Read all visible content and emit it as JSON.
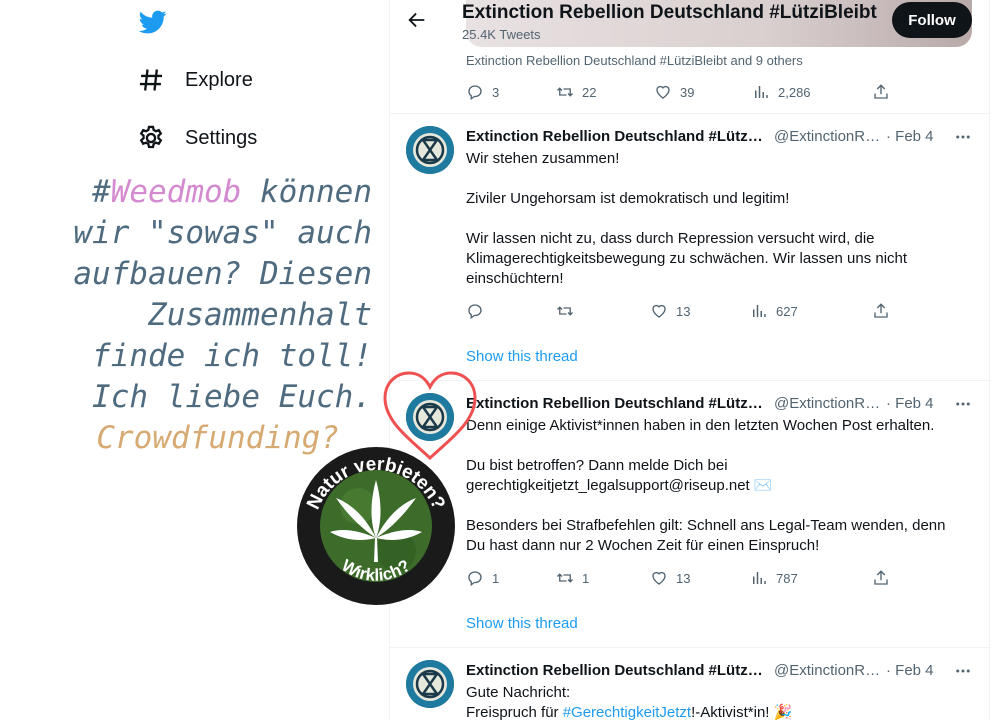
{
  "sidebar": {
    "items": [
      {
        "label": "Explore",
        "icon": "hashtag-icon"
      },
      {
        "label": "Settings",
        "icon": "gear-icon"
      }
    ]
  },
  "overlay": {
    "lines": [
      {
        "parts": [
          "#",
          "Weedmob",
          " können"
        ]
      },
      {
        "text": "wir \"sowas\" auch"
      },
      {
        "text": "aufbauen? Diesen"
      },
      {
        "text": "Zusammenhalt"
      },
      {
        "text": "finde ich toll!"
      },
      {
        "text": "Ich liebe Euch."
      },
      {
        "text": "Crowdfunding?"
      }
    ],
    "sticker_top": "Natur verbieten?",
    "sticker_bottom": "Wirklich?"
  },
  "header": {
    "title": "Extinction Rebellion Deutschland #LütziBleibt",
    "tweet_count": "25.4K Tweets",
    "follow_label": "Follow"
  },
  "top_tweet": {
    "liked_by": "Extinction Rebellion Deutschland #LütziBleibt and 9 others",
    "replies": "3",
    "retweets": "22",
    "likes": "39",
    "views": "2,286"
  },
  "tweets": [
    {
      "name": "Extinction Rebellion Deutschland #LütziBleibt",
      "handle": "@ExtinctionRebellion",
      "date": "· Feb 4",
      "paragraphs": [
        "Wir stehen zusammen!",
        "Ziviler Ungehorsam ist demokratisch und legitim!",
        "Wir lassen nicht zu, dass durch Repression versucht wird, die Klimagerechtigkeitsbewegung zu schwächen. Wir lassen uns nicht einschüchtern!"
      ],
      "replies": "",
      "retweets": "",
      "likes": "13",
      "views": "627",
      "show_thread": "Show this thread"
    },
    {
      "name": "Extinction Rebellion Deutschland #LütziBleibt",
      "handle": "@ExtinctionRebellion",
      "date": "· Feb 4",
      "paragraphs": [
        "Denn einige Aktivist*innen haben in den letzten Wochen Post erhalten.",
        "Du bist betroffen? Dann melde Dich bei gerechtigkeitjetzt_legalsupport@riseup.net ✉️",
        "Besonders bei Strafbefehlen gilt: Schnell ans Legal-Team wenden, denn Du hast dann nur 2 Wochen Zeit für einen Einspruch!"
      ],
      "replies": "1",
      "retweets": "1",
      "likes": "13",
      "views": "787",
      "show_thread": "Show this thread"
    },
    {
      "name": "Extinction Rebellion Deutschland #LütziBleibt",
      "handle": "@ExtinctionRebellion",
      "date": "· Feb 4",
      "line1": "Gute Nachricht:",
      "line2_pre": "Freispruch für ",
      "line2_link": "#GerechtigkeitJetzt",
      "line2_post": "!-Aktivist*in! 🎉"
    }
  ],
  "colors": {
    "accent": "#1d9bf0",
    "overlay_text": "#4f6b80",
    "overlay_pink": "#d48ad0",
    "overlay_tan": "#d6aa72"
  }
}
